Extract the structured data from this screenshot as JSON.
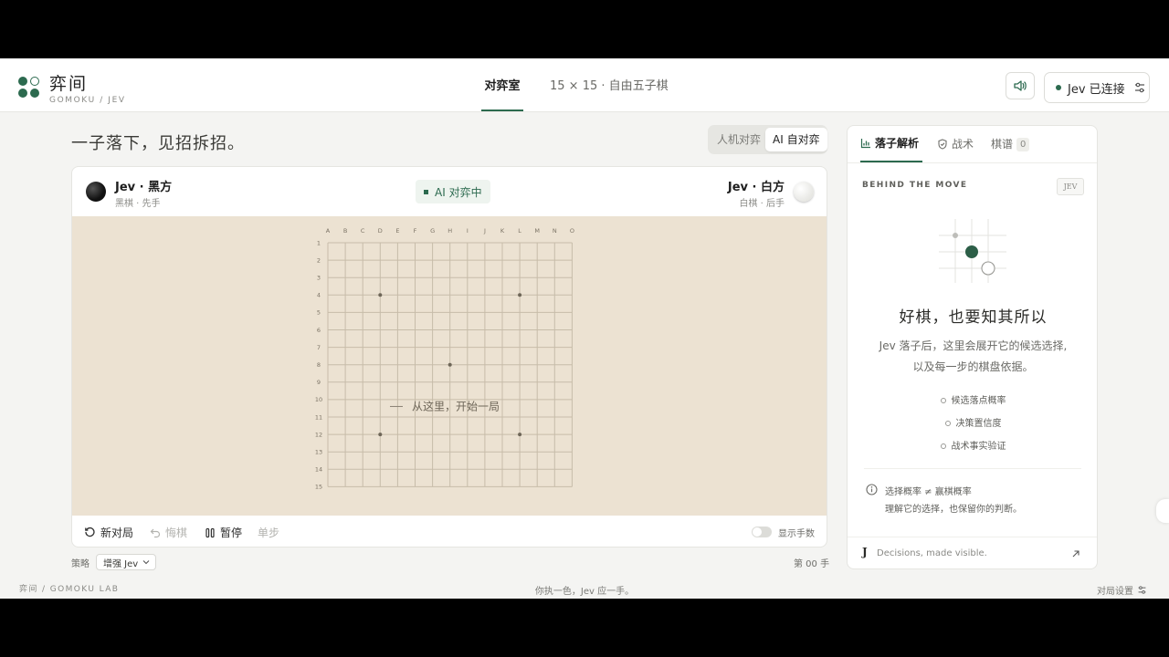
{
  "colors": {
    "accent": "#2c6a4f",
    "board": "#ece2d2",
    "grid": "#c7bca9"
  },
  "header": {
    "brand_name": "弈间",
    "brand_sub": "GOMOKU / JEV",
    "nav_active": "对弈室",
    "nav_info": "15 × 15 · 自由五子棋",
    "sound_icon": "speaker-icon",
    "connection": "Jev 已连接"
  },
  "hero": {
    "tagline": "一子落下，见招拆招。"
  },
  "mode": {
    "human_vs_ai": "人机对弈",
    "ai_self_play": "AI 自对弈",
    "selected": "AI 自对弈"
  },
  "players": {
    "black": {
      "name": "Jev · 黑方",
      "sub": "黑棋 · 先手"
    },
    "white": {
      "name": "Jev · 白方",
      "sub": "白棋 · 后手"
    }
  },
  "status": "AI 对弈中",
  "board": {
    "size": 15,
    "columns": [
      "A",
      "B",
      "C",
      "D",
      "E",
      "F",
      "G",
      "H",
      "I",
      "J",
      "K",
      "L",
      "M",
      "N",
      "O"
    ],
    "rows": [
      "1",
      "2",
      "3",
      "4",
      "5",
      "6",
      "7",
      "8",
      "9",
      "10",
      "11",
      "12",
      "13",
      "14",
      "15"
    ],
    "star_points": [
      "D4",
      "L4",
      "H8",
      "D12",
      "L12"
    ],
    "empty_hint": "从这里，开始一局"
  },
  "controls": {
    "new_game": "新对局",
    "undo": "悔棋",
    "pause": "暂停",
    "step": "单步",
    "show_moves": "显示手数",
    "show_moves_on": false
  },
  "strategy": {
    "label": "策略",
    "value": "增强 Jev"
  },
  "move_count": "第 00 手",
  "panel": {
    "tabs": [
      {
        "label": "落子解析",
        "icon": "bar-chart-icon"
      },
      {
        "label": "战术",
        "icon": "shield-icon"
      },
      {
        "label": "棋谱",
        "count": "0"
      }
    ],
    "kicker": "BEHIND THE MOVE",
    "chip": "JEV",
    "title": "好棋，也要知其所以",
    "desc_1": "Jev 落子后，这里会展开它的候选选择,",
    "desc_2": "以及每一步的棋盘依据。",
    "features": [
      "候选落点概率",
      "决策置信度",
      "战术事实验证"
    ],
    "note_title": "选择概率 ≠ 赢棋概率",
    "note_body": "理解它的选择，也保留你的判断。",
    "foot_mark": "J",
    "foot_text": "Decisions, made visible."
  },
  "footer": {
    "left": "弈间 / GOMOKU LAB",
    "center": "你执一色，Jev 应一手。",
    "right": "对局设置"
  }
}
